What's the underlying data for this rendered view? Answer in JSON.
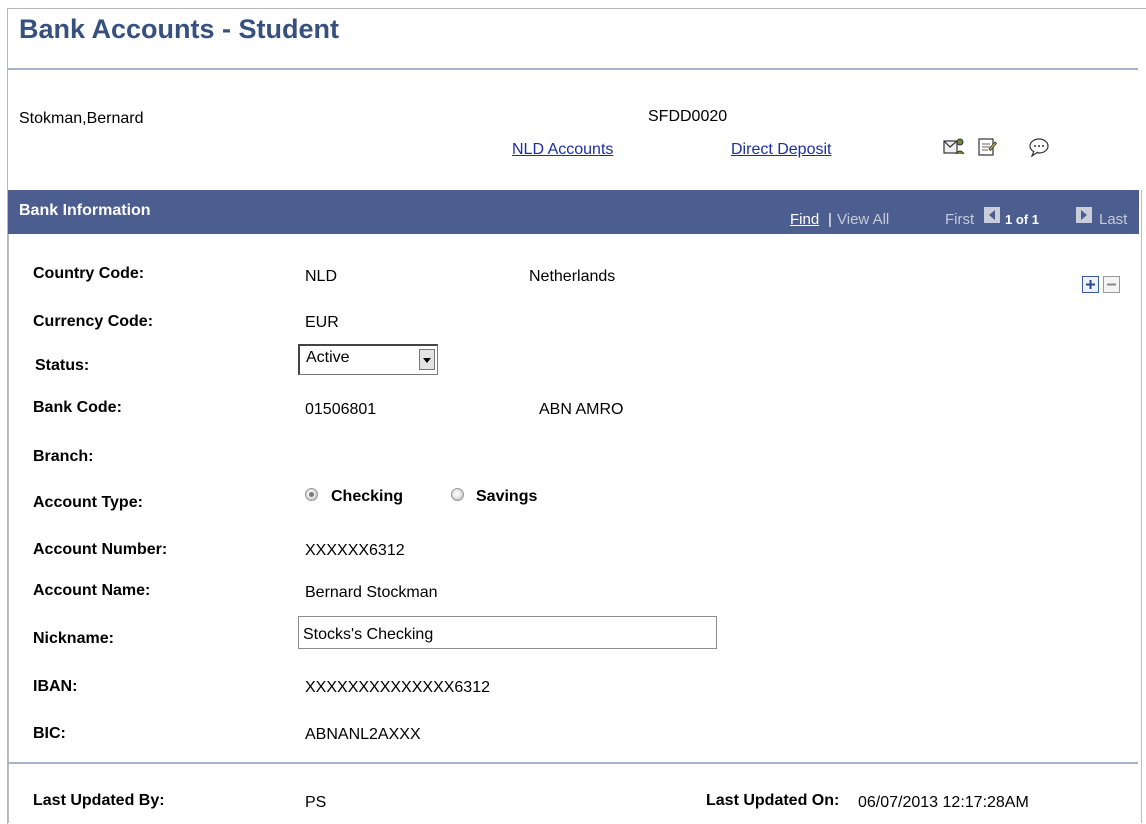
{
  "page": {
    "title": "Bank Accounts - Student"
  },
  "student": {
    "name": "Stokman,Bernard",
    "id": "SFDD0020"
  },
  "links": {
    "nld_accounts": "NLD Accounts",
    "direct_deposit": "Direct Deposit"
  },
  "toolbar_icons": [
    "notify-icon",
    "notepad-icon",
    "comment-icon"
  ],
  "group": {
    "title": "Bank Information",
    "find": "Find",
    "separator": "|",
    "view_all": "View All",
    "first": "First",
    "page_count": "1 of 1",
    "last": "Last"
  },
  "fields": {
    "country_code": {
      "label": "Country Code:",
      "value": "NLD",
      "description": "Netherlands"
    },
    "currency_code": {
      "label": "Currency Code:",
      "value": "EUR"
    },
    "status": {
      "label": "Status:",
      "value": "Active"
    },
    "bank_code": {
      "label": "Bank Code:",
      "value": "01506801",
      "description": "ABN AMRO"
    },
    "branch": {
      "label": "Branch:"
    },
    "account_type": {
      "label": "Account Type:",
      "options": [
        "Checking",
        "Savings"
      ],
      "selected": "Checking"
    },
    "account_number": {
      "label": "Account Number:",
      "value": "XXXXXX6312"
    },
    "account_name": {
      "label": "Account Name:",
      "value": "Bernard Stockman"
    },
    "nickname": {
      "label": "Nickname:",
      "value": "Stocks's Checking"
    },
    "iban": {
      "label": "IBAN:",
      "value": "XXXXXXXXXXXXXX6312"
    },
    "bic": {
      "label": "BIC:",
      "value": "ABNANL2AXXX"
    }
  },
  "footer": {
    "last_updated_by_label": "Last Updated By:",
    "last_updated_by": "PS",
    "last_updated_on_label": "Last Updated On:",
    "last_updated_on": "06/07/2013 12:17:28AM"
  },
  "colors": {
    "title": "#36507f",
    "header_bar": "#4c5d8f",
    "link": "#1a2ea8"
  }
}
